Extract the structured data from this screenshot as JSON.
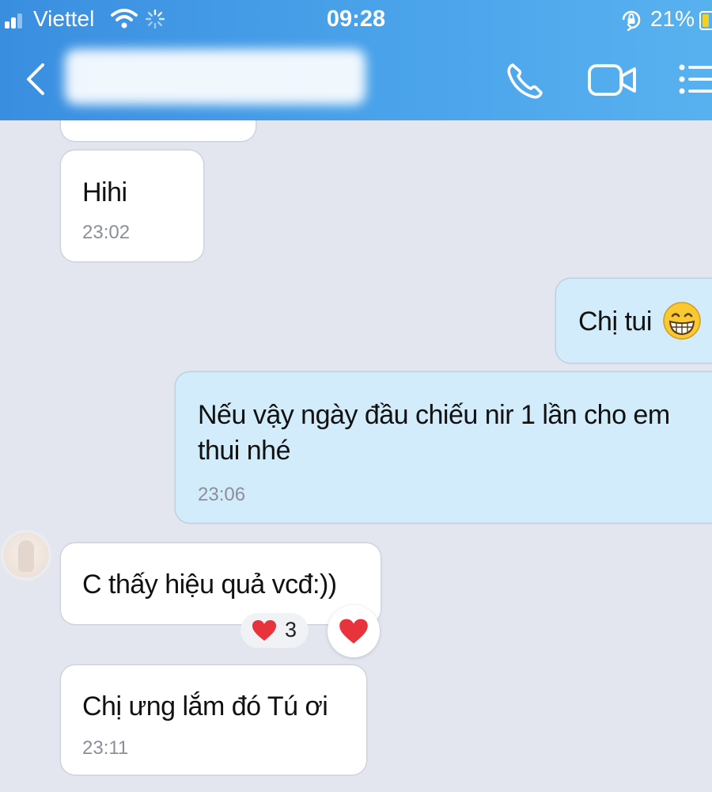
{
  "status_bar": {
    "carrier": "Viettel",
    "time": "09:28",
    "battery_percent": "21%",
    "battery_level": 0.21
  },
  "header": {
    "contact_name_blurred": true,
    "icons": [
      "back-icon",
      "phone-icon",
      "video-camera-icon",
      "menu-icon"
    ]
  },
  "messages": [
    {
      "direction": "incoming",
      "text": "Hihi",
      "time": "23:02"
    },
    {
      "direction": "outgoing",
      "text": "Chị tui",
      "emoji": "grinning-face"
    },
    {
      "direction": "outgoing",
      "text_line1": "Nếu vậy ngày đầu chiếu nir 1 lần cho em",
      "text_line2": "thui nhé",
      "time": "23:06"
    },
    {
      "direction": "incoming",
      "text": "C thấy hiệu quả vcđ:))",
      "reaction_count": "3",
      "reaction": "heart"
    },
    {
      "direction": "incoming",
      "text": "Chị ưng lắm đó Tú ơi",
      "time": "23:11"
    }
  ],
  "colors": {
    "header_start": "#3a8ee0",
    "header_end": "#58b1ef",
    "chat_background": "#e3e6ee",
    "incoming_bubble": "#ffffff",
    "outgoing_bubble": "#d3ecfb",
    "heart": "#e8323c"
  }
}
